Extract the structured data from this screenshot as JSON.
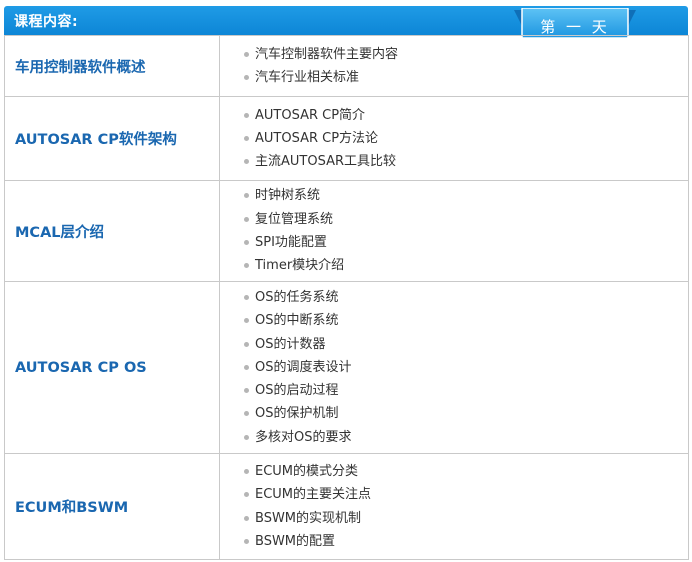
{
  "header": {
    "title": "课程内容:",
    "day_badge": "第 一 天"
  },
  "colors": {
    "header_blue": "#0d86d6",
    "topic_blue": "#1a67b0",
    "bullet_gray": "#b5b5b5",
    "border_gray": "#c9c9c9"
  },
  "rows": [
    {
      "topic": "车用控制器软件概述",
      "points": [
        "汽车控制器软件主要内容",
        "汽车行业相关标准"
      ]
    },
    {
      "topic": "AUTOSAR CP软件架构",
      "points": [
        "AUTOSAR CP简介",
        "AUTOSAR CP方法论",
        "主流AUTOSAR工具比较"
      ]
    },
    {
      "topic": "MCAL层介绍",
      "points": [
        "时钟树系统",
        "复位管理系统",
        "SPI功能配置",
        "Timer模块介绍"
      ]
    },
    {
      "topic": "AUTOSAR CP OS",
      "points": [
        "OS的任务系统",
        "OS的中断系统",
        "OS的计数器",
        "OS的调度表设计",
        "OS的启动过程",
        "OS的保护机制",
        "多核对OS的要求"
      ]
    },
    {
      "topic": "ECUM和BSWM",
      "points": [
        "ECUM的模式分类",
        "ECUM的主要关注点",
        "BSWM的实现机制",
        "BSWM的配置"
      ]
    }
  ]
}
